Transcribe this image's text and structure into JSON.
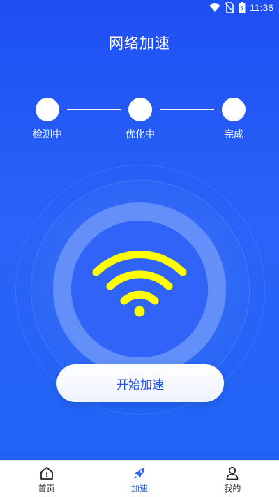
{
  "status_bar": {
    "time": "11:36",
    "icons": [
      "wifi-icon",
      "no-sim-icon",
      "battery-charging-icon"
    ]
  },
  "header": {
    "title": "网络加速"
  },
  "steps": [
    {
      "label": "检测中"
    },
    {
      "label": "优化中"
    },
    {
      "label": "完成"
    }
  ],
  "center": {
    "icon": "wifi-icon",
    "wifi_color": "#ffff00"
  },
  "action": {
    "start_label": "开始加速"
  },
  "tab_bar": {
    "tabs": [
      {
        "label": "首页",
        "icon": "home-icon",
        "active": false
      },
      {
        "label": "加速",
        "icon": "rocket-icon",
        "active": true
      },
      {
        "label": "我的",
        "icon": "user-icon",
        "active": false
      }
    ]
  },
  "colors": {
    "background": "#2a5ff5",
    "accent": "#2b63f3",
    "wifi": "#ffff00"
  }
}
